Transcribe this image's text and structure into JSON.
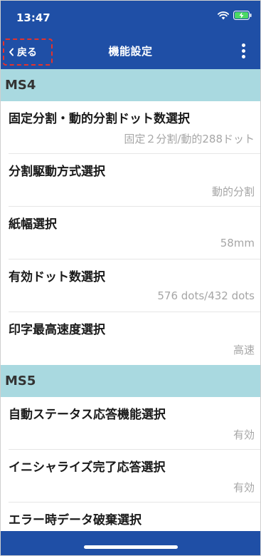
{
  "status_bar": {
    "time": "13:47"
  },
  "nav": {
    "back_label": "戻る",
    "title": "機能設定"
  },
  "sections": [
    {
      "title": "MS4",
      "rows": [
        {
          "title": "固定分割・動的分割ドット数選択",
          "value": "固定２分割/動的288ドット"
        },
        {
          "title": "分割駆動方式選択",
          "value": "動的分割"
        },
        {
          "title": "紙幅選択",
          "value": "58mm"
        },
        {
          "title": "有効ドット数選択",
          "value": "576 dots/432 dots"
        },
        {
          "title": "印字最高速度選択",
          "value": "高速"
        }
      ]
    },
    {
      "title": "MS5",
      "rows": [
        {
          "title": "自動ステータス応答機能選択",
          "value": "有効"
        },
        {
          "title": "イニシャライズ完了応答選択",
          "value": "有効"
        },
        {
          "title": "エラー時データ破棄選択",
          "value": ""
        }
      ]
    }
  ],
  "colors": {
    "primary": "#1f4fa6",
    "section_bg": "#a9d9e0",
    "value_text": "#a6a6a6",
    "highlight_border": "#e5322b"
  },
  "icons": {
    "back": "chevron-left-icon",
    "more": "more-vertical-icon",
    "wifi": "wifi-icon",
    "battery": "battery-charging-icon"
  }
}
